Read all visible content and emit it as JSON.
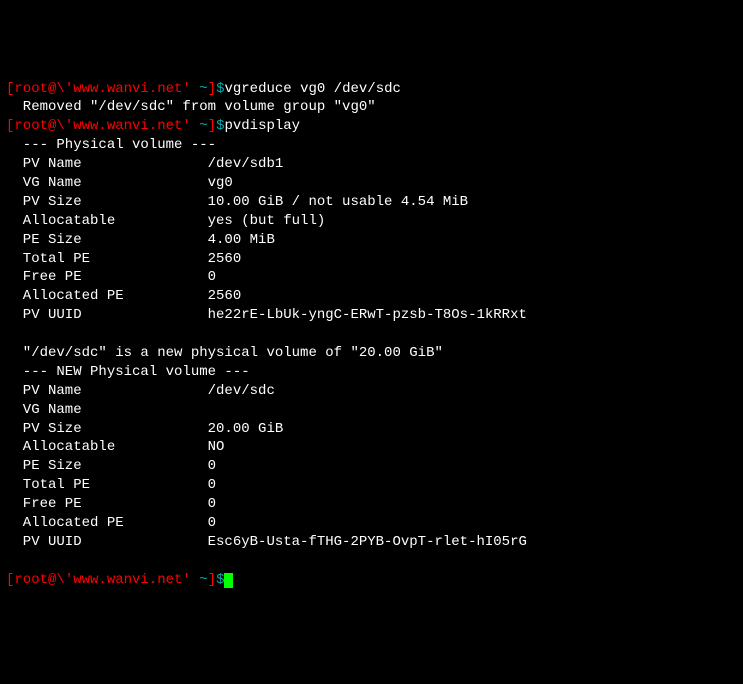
{
  "lines": [
    {
      "prompt": true,
      "cmd": "vgreduce vg0 /dev/sdc"
    },
    {
      "text": "  Removed \"/dev/sdc\" from volume group \"vg0\""
    },
    {
      "prompt": true,
      "cmd": "pvdisplay"
    },
    {
      "text": "  --- Physical volume ---"
    },
    {
      "text": "  PV Name               /dev/sdb1"
    },
    {
      "text": "  VG Name               vg0"
    },
    {
      "text": "  PV Size               10.00 GiB / not usable 4.54 MiB"
    },
    {
      "text": "  Allocatable           yes (but full)"
    },
    {
      "text": "  PE Size               4.00 MiB"
    },
    {
      "text": "  Total PE              2560"
    },
    {
      "text": "  Free PE               0"
    },
    {
      "text": "  Allocated PE          2560"
    },
    {
      "text": "  PV UUID               he22rE-LbUk-yngC-ERwT-pzsb-T8Os-1kRRxt"
    },
    {
      "text": "   "
    },
    {
      "text": "  \"/dev/sdc\" is a new physical volume of \"20.00 GiB\""
    },
    {
      "text": "  --- NEW Physical volume ---"
    },
    {
      "text": "  PV Name               /dev/sdc"
    },
    {
      "text": "  VG Name               "
    },
    {
      "text": "  PV Size               20.00 GiB"
    },
    {
      "text": "  Allocatable           NO"
    },
    {
      "text": "  PE Size               0   "
    },
    {
      "text": "  Total PE              0"
    },
    {
      "text": "  Free PE               0"
    },
    {
      "text": "  Allocated PE          0"
    },
    {
      "text": "  PV UUID               Esc6yB-Usta-fTHG-2PYB-OvpT-rlet-hI05rG"
    },
    {
      "text": "   "
    },
    {
      "prompt": true,
      "cmd": "",
      "cursor": true
    }
  ],
  "prompt": {
    "openBracket": "[",
    "user": "root@\\'www.wanvi.net'",
    "space": " ",
    "dir": "~",
    "closeBracket": "]",
    "sigil": "$"
  }
}
